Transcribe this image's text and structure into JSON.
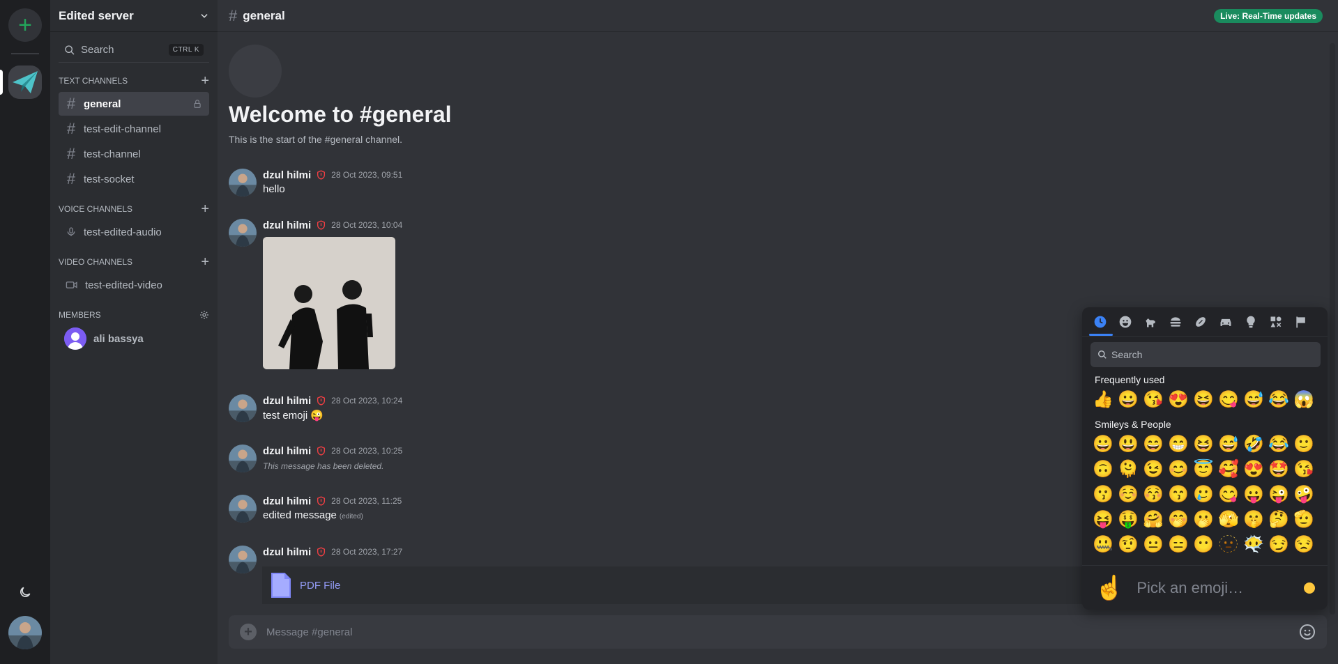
{
  "rail": {
    "add_label": "+"
  },
  "server": {
    "name": "Edited server"
  },
  "sidebar": {
    "search_label": "Search",
    "search_shortcut": "CTRL K",
    "text_category": "TEXT CHANNELS",
    "text_channels": [
      "general",
      "test-edit-channel",
      "test-channel",
      "test-socket"
    ],
    "voice_category": "VOICE CHANNELS",
    "voice_channels": [
      "test-edited-audio"
    ],
    "video_category": "VIDEO CHANNELS",
    "video_channels": [
      "test-edited-video"
    ],
    "members_category": "MEMBERS",
    "members": [
      "ali bassya"
    ]
  },
  "header": {
    "channel": "general",
    "live_badge": "Live: Real-Time updates"
  },
  "welcome": {
    "title": "Welcome to #general",
    "subtitle": "This is the start of the #general channel."
  },
  "messages": [
    {
      "author": "dzul hilmi",
      "time": "28 Oct 2023, 09:51",
      "text": "hello"
    },
    {
      "author": "dzul hilmi",
      "time": "28 Oct 2023, 10:04",
      "text": ""
    },
    {
      "author": "dzul hilmi",
      "time": "28 Oct 2023, 10:24",
      "text": "test emoji 😜"
    },
    {
      "author": "dzul hilmi",
      "time": "28 Oct 2023, 10:25",
      "text": "This message has been deleted."
    },
    {
      "author": "dzul hilmi",
      "time": "28 Oct 2023, 11:25",
      "text": "edited message",
      "edited": "(edited)"
    },
    {
      "author": "dzul hilmi",
      "time": "28 Oct 2023, 17:27",
      "text": ""
    }
  ],
  "attachment": {
    "pdf_label": "PDF File"
  },
  "composer": {
    "placeholder": "Message #general"
  },
  "emoji_picker": {
    "search_placeholder": "Search",
    "frequent_label": "Frequently used",
    "frequent": [
      "👍",
      "😀",
      "😘",
      "😍",
      "😆",
      "😋",
      "😅",
      "😂",
      "😱"
    ],
    "smileys_label": "Smileys & People",
    "smileys": [
      [
        "😀",
        "😃",
        "😄",
        "😁",
        "😆",
        "😅",
        "🤣",
        "😂",
        "🙂"
      ],
      [
        "🙃",
        "🫠",
        "😉",
        "😊",
        "😇",
        "🥰",
        "😍",
        "🤩",
        "😘"
      ],
      [
        "😗",
        "☺️",
        "😚",
        "😙",
        "🥲",
        "😋",
        "😛",
        "😜",
        "🤪"
      ],
      [
        "😝",
        "🤑",
        "🤗",
        "🤭",
        "🫢",
        "🫣",
        "🤫",
        "🤔",
        "🫡"
      ],
      [
        "🤐",
        "🤨",
        "😐",
        "😑",
        "😶",
        "🫥",
        "😶‍🌫️",
        "😏",
        "😒"
      ]
    ],
    "preview_emoji": "☝️",
    "preview_label": "Pick an emoji…"
  },
  "colors": {
    "accent": "#5865f2",
    "online": "#23a55a",
    "live": "#1a8b5e",
    "picker_tab": "#3b82f6"
  }
}
